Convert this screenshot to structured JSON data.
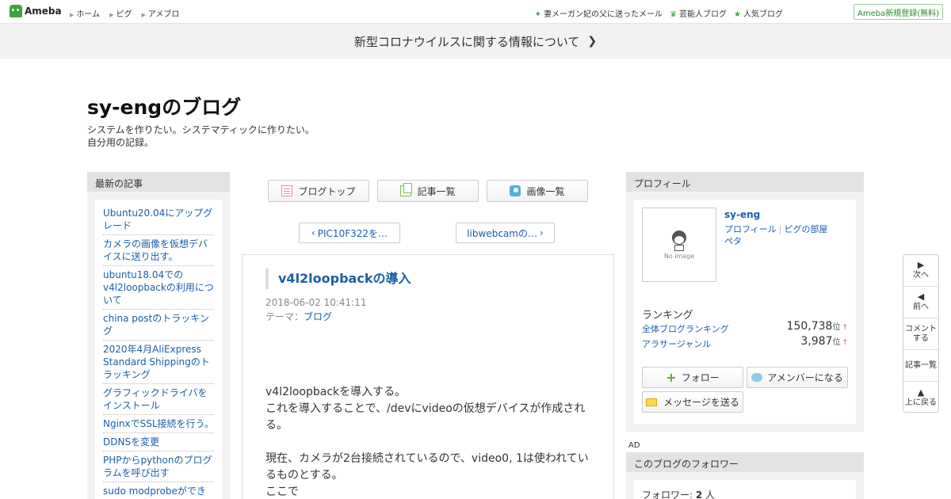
{
  "topnav": {
    "logo": "Ameba",
    "links": [
      "ホーム",
      "ピグ",
      "アメブロ"
    ],
    "right_links": [
      "妻メーガン妃の父に送ったメール",
      "芸能人ブログ",
      "人気ブログ"
    ],
    "register": "Ameba新規登録(無料)"
  },
  "banner": {
    "text": "新型コロナウイルスに関する情報について"
  },
  "blog": {
    "title": "sy-engのブログ",
    "desc1": "システムを作りたい。システマティックに作りたい。",
    "desc2": "自分用の記録。"
  },
  "left": {
    "heading": "最新の記事",
    "items": [
      "Ubuntu20.04にアップグレード",
      "カメラの画像を仮想デバイスに送り出す。",
      "ubuntu18.04でのv4l2loopbackの利用について",
      "china postのトラッキング",
      "2020年4月AliExpress Standard Shippingのトラッキング",
      "グラフィックドライバをインストール",
      "NginxでSSL接続を行う。",
      "DDNSを変更",
      "PHPからpythonのプログラムを呼び出す",
      "sudo modprobeができない。"
    ]
  },
  "center": {
    "btn_top": "ブログトップ",
    "btn_list": "記事一覧",
    "btn_images": "画像一覧",
    "prev": "PIC10F322を…",
    "next": "libwebcamの…"
  },
  "article": {
    "title": "v4l2loopbackの導入",
    "date": "2018-06-02 10:41:11",
    "theme_label": "テーマ：",
    "theme": "ブログ",
    "body1": "v4l2loopbackを導入する。",
    "body2": "これを導入することで、/devにvideoの仮想デバイスが作成される。",
    "body3": "現在、カメラが2台接続されているので、video0, 1は使われているものとする。",
    "body4": "ここで"
  },
  "profile": {
    "heading": "プロフィール",
    "no_image": "No image",
    "name": "sy-eng",
    "link_profile": "プロフィール",
    "link_room": "ピグの部屋",
    "link_peta": "ペタ",
    "ranking": "ランキング",
    "rank1_label": "全体ブログランキング",
    "rank1_value": "150,738",
    "rank2_label": "アラサージャンル",
    "rank2_value": "3,987",
    "rank_unit": "位",
    "rank_arrow": "↑",
    "follow": "フォロー",
    "amember": "アメンバーになる",
    "message": "メッセージを送る"
  },
  "ad": "AD",
  "followers": {
    "heading": "このブログのフォロワー",
    "label": "フォロワー: ",
    "count": "2",
    "unit": " 人"
  },
  "sidenav": {
    "next": "次へ",
    "prev": "前へ",
    "comment1": "コメント",
    "comment2": "する",
    "list": "記事一覧",
    "top": "上に戻る"
  }
}
